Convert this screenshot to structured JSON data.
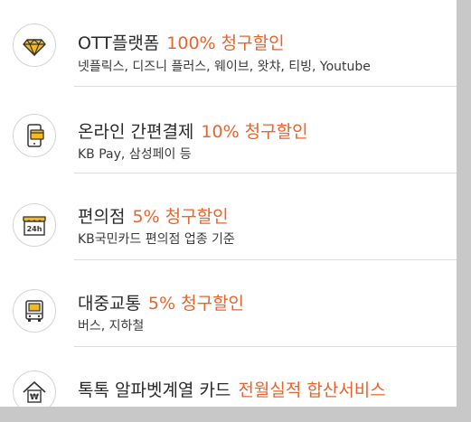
{
  "benefits": [
    {
      "title": "OTT플랫폼",
      "discount": "100% 청구할인",
      "sub": "넷플릭스, 디즈니 플러스, 웨이브, 왓챠, 티빙, Youtube",
      "icon": "diamond-icon"
    },
    {
      "title": "온라인 간편결제",
      "discount": "10% 청구할인",
      "sub": "KB Pay, 삼성페이 등",
      "icon": "mobile-card-icon"
    },
    {
      "title": "편의점",
      "discount": "5% 청구할인",
      "sub": "KB국민카드 편의점 업종 기준",
      "icon": "store-24h-icon"
    },
    {
      "title": "대중교통",
      "discount": "5% 청구할인",
      "sub": "버스, 지하철",
      "icon": "bus-icon"
    },
    {
      "title": "톡톡 알파벳계열 카드",
      "discount": "전월실적 합산서비스",
      "sub": "",
      "icon": "house-won-icon"
    }
  ],
  "icon_text": {
    "store_24h": "24h",
    "won": "₩"
  },
  "colors": {
    "accent": "#e8642c",
    "icon_gold": "#e0a81a",
    "icon_dark": "#333333"
  }
}
